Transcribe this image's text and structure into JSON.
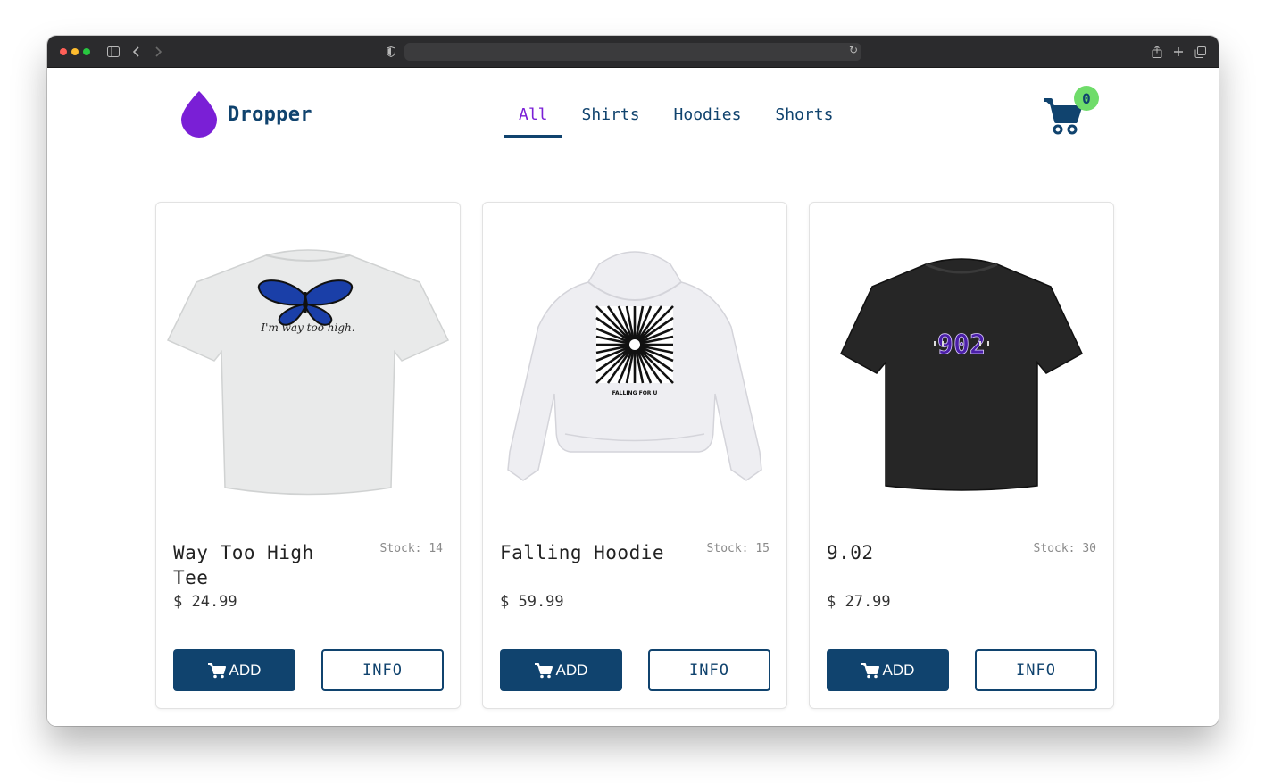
{
  "brand": {
    "name": "Dropper",
    "logo_icon": "droplet-icon",
    "color": "#7a1fd6",
    "text_color": "#10436e"
  },
  "nav": {
    "items": [
      {
        "label": "All",
        "active": true
      },
      {
        "label": "Shirts",
        "active": false
      },
      {
        "label": "Hoodies",
        "active": false
      },
      {
        "label": "Shorts",
        "active": false
      }
    ]
  },
  "cart": {
    "icon": "cart-icon",
    "count": "0",
    "badge_color": "#6fdc6a"
  },
  "products": [
    {
      "name": "Way Too High Tee",
      "stock": "Stock: 14",
      "price": "$ 24.99",
      "add_label": "ADD",
      "info_label": "INFO",
      "image": "white-tshirt-butterfly-graphic",
      "print_text": "I'm way too high."
    },
    {
      "name": "Falling Hoodie",
      "stock": "Stock: 15",
      "price": "$ 59.99",
      "add_label": "ADD",
      "info_label": "INFO",
      "image": "white-hoodie-sunburst-graphic",
      "print_text": "FALLING FOR U"
    },
    {
      "name": "9.02",
      "stock": "Stock: 30",
      "price": "$ 27.99",
      "add_label": "ADD",
      "info_label": "INFO",
      "image": "black-tshirt-902-graphic",
      "print_text": "902"
    }
  ],
  "colors": {
    "primary": "#10436e",
    "accent": "#7a1fd6"
  }
}
